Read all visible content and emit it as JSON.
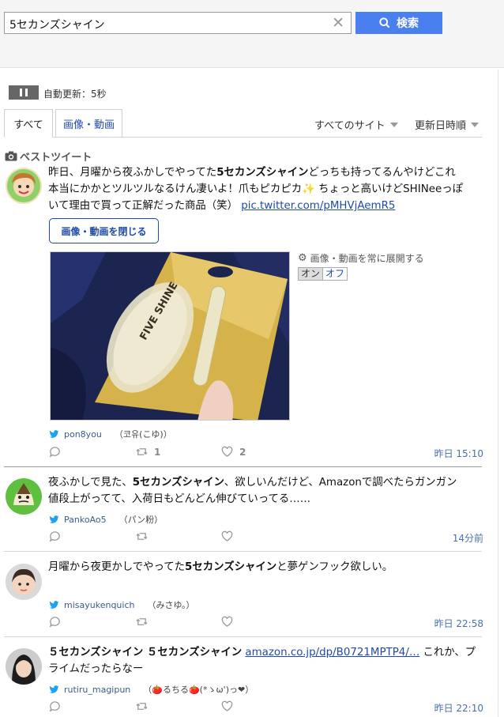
{
  "search": {
    "value": "5セカンズシャイン",
    "clear_label": "✕",
    "button_label": "検索"
  },
  "autoupdate": {
    "label": "自動更新：5秒"
  },
  "tabs": [
    {
      "label": "すべて"
    },
    {
      "label": "画像・動画"
    }
  ],
  "filters": {
    "site": "すべてのサイト",
    "sort": "更新日時順"
  },
  "best_label": "ベストツイート",
  "media_controls": {
    "close_label": "画像・動画を閉じる",
    "expand_label": "画像・動画を常に展開する",
    "on": "オン",
    "off": "オフ"
  },
  "tweets": [
    {
      "line1_pre": "昨日、月曜から夜ふかしでやってた",
      "line1_bold": "5セカンズシャイン",
      "line1_post": "どっちも持ってるんやけどこれ",
      "line2": "本当にかかとツルツルなるけん凄いよ！爪もピカピカ",
      "line2_post": " ちょっと高いけどSHINeeっぽ",
      "line3": "いて理由で買って正解だった商品（笑） ",
      "link": "pic.twitter.com/pMHVjAemR5",
      "handle": "pon8you",
      "display": "（코유(こゆ)）",
      "retweets": "1",
      "likes": "2",
      "time": "昨日 15:10"
    },
    {
      "line1_pre": "夜ふかしで見た、",
      "line1_bold": "5セカンズシャイン",
      "line1_post": "、欲しいんだけど、Amazonで調べたらガンガン",
      "line2": "値段上がってて、入荷日もどんどん伸びていってる……",
      "handle": "PankoAo5",
      "display": "（パン粉）",
      "time": "14分前"
    },
    {
      "line1_pre": "月曜から夜更かしでやってた",
      "line1_bold": "5セカンズシャイン",
      "line1_post": "と夢ゲンフック欲しい。",
      "handle": "misayukenquich",
      "display": "（みさゆ。）",
      "time": "昨日 22:58"
    },
    {
      "line1_bold": "５セカンズシャイン ５セカンズシャイン",
      "link": "amazon.co.jp/dp/B0721MPTP4/…",
      "line1_post": " これか、プ",
      "line2": "ライムだったらなー",
      "handle": "rutiru_magipun",
      "display": "（🍅るちる🍅(*ゝω')っ❤）",
      "time": "昨日 22:10"
    }
  ],
  "image": {
    "brand_text": "FIVE SHINE",
    "colors": {
      "bg": "#1c2550",
      "card": "#d6b24a",
      "stone": "#e8e2c6"
    }
  },
  "colors": {
    "accent": "#4a7ff0",
    "link": "#1f4aa8",
    "twitter": "#1da1f2"
  }
}
